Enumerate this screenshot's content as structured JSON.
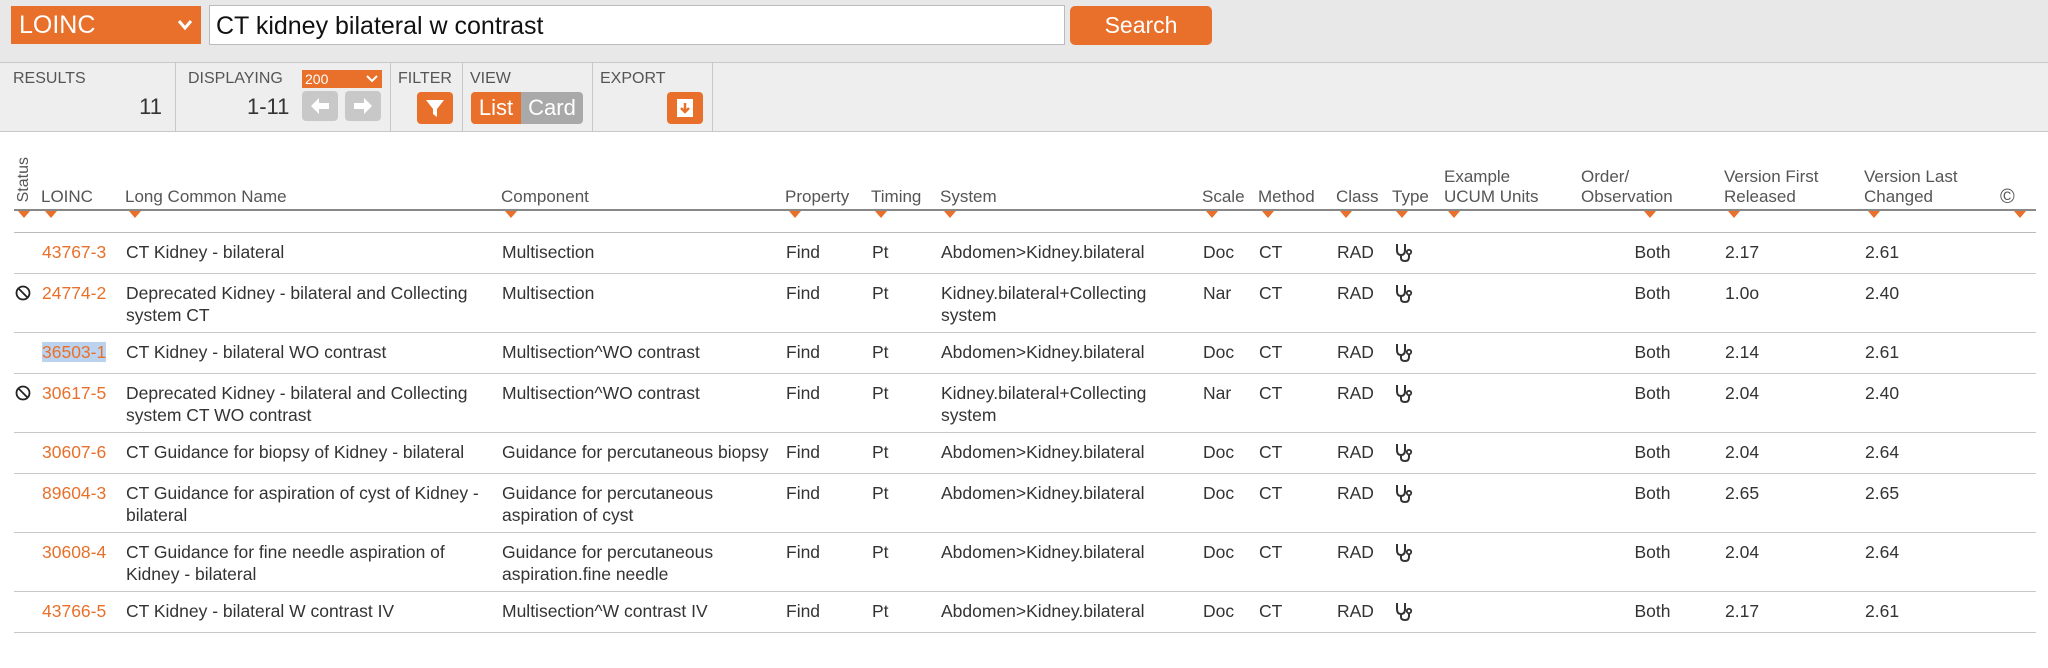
{
  "search": {
    "db": "LOINC",
    "query": "CT kidney bilateral w contrast",
    "button": "Search"
  },
  "toolbar": {
    "results_label": "RESULTS",
    "results_count": "11",
    "displaying_label": "DISPLAYING",
    "per_page": "200",
    "range": "1-11",
    "filter_label": "FILTER",
    "view_label": "VIEW",
    "view_list": "List",
    "view_card": "Card",
    "export_label": "EXPORT"
  },
  "columns": {
    "status": "Status",
    "loinc": "LOINC",
    "long_name": "Long Common Name",
    "component": "Component",
    "property": "Property",
    "timing": "Timing",
    "system": "System",
    "scale": "Scale",
    "method": "Method",
    "class": "Class",
    "type": "Type",
    "ucum_1": "Example",
    "ucum_2": "UCUM Units",
    "order_1": "Order/",
    "order_2": "Observation",
    "first_1": "Version First",
    "first_2": "Released",
    "last_1": "Version Last",
    "last_2": "Changed",
    "copyright": "©"
  },
  "rows": [
    {
      "status_icon": "",
      "loinc": "43767-3",
      "name": "CT Kidney - bilateral",
      "component": "Multisection",
      "property": "Find",
      "timing": "Pt",
      "system": "Abdomen>Kidney.bilateral",
      "scale": "Doc",
      "method": "CT",
      "class": "RAD",
      "type_icon": "stethoscope-icon",
      "ucum": "",
      "order": "Both",
      "first": "2.17",
      "last": "2.61"
    },
    {
      "status_icon": "deprecated-icon",
      "loinc": "24774-2",
      "name": "Deprecated Kidney - bilateral and Collecting system CT",
      "component": "Multisection",
      "property": "Find",
      "timing": "Pt",
      "system": "Kidney.bilateral+Collecting system",
      "scale": "Nar",
      "method": "CT",
      "class": "RAD",
      "type_icon": "stethoscope-icon",
      "ucum": "",
      "order": "Both",
      "first": "1.0o",
      "last": "2.40"
    },
    {
      "status_icon": "",
      "loinc": "36503-1",
      "name": "CT Kidney - bilateral WO contrast",
      "component": "Multisection^WO contrast",
      "property": "Find",
      "timing": "Pt",
      "system": "Abdomen>Kidney.bilateral",
      "scale": "Doc",
      "method": "CT",
      "class": "RAD",
      "type_icon": "stethoscope-icon",
      "ucum": "",
      "order": "Both",
      "first": "2.14",
      "last": "2.61"
    },
    {
      "status_icon": "deprecated-icon",
      "loinc": "30617-5",
      "name": "Deprecated Kidney - bilateral and Collecting system CT WO contrast",
      "component": "Multisection^WO contrast",
      "property": "Find",
      "timing": "Pt",
      "system": "Kidney.bilateral+Collecting system",
      "scale": "Nar",
      "method": "CT",
      "class": "RAD",
      "type_icon": "stethoscope-icon",
      "ucum": "",
      "order": "Both",
      "first": "2.04",
      "last": "2.40"
    },
    {
      "status_icon": "",
      "loinc": "30607-6",
      "name": "CT Guidance for biopsy of Kidney - bilateral",
      "component": "Guidance for percutaneous biopsy",
      "property": "Find",
      "timing": "Pt",
      "system": "Abdomen>Kidney.bilateral",
      "scale": "Doc",
      "method": "CT",
      "class": "RAD",
      "type_icon": "stethoscope-icon",
      "ucum": "",
      "order": "Both",
      "first": "2.04",
      "last": "2.64"
    },
    {
      "status_icon": "",
      "loinc": "89604-3",
      "name": "CT Guidance for aspiration of cyst of Kidney - bilateral",
      "component": "Guidance for percutaneous aspiration of cyst",
      "property": "Find",
      "timing": "Pt",
      "system": "Abdomen>Kidney.bilateral",
      "scale": "Doc",
      "method": "CT",
      "class": "RAD",
      "type_icon": "stethoscope-icon",
      "ucum": "",
      "order": "Both",
      "first": "2.65",
      "last": "2.65"
    },
    {
      "status_icon": "",
      "loinc": "30608-4",
      "name": "CT Guidance for fine needle aspiration of Kidney - bilateral",
      "component": "Guidance for percutaneous aspiration.fine needle",
      "property": "Find",
      "timing": "Pt",
      "system": "Abdomen>Kidney.bilateral",
      "scale": "Doc",
      "method": "CT",
      "class": "RAD",
      "type_icon": "stethoscope-icon",
      "ucum": "",
      "order": "Both",
      "first": "2.04",
      "last": "2.64"
    },
    {
      "status_icon": "",
      "loinc": "43766-5",
      "name": "CT Kidney - bilateral W contrast IV",
      "component": "Multisection^W contrast IV",
      "property": "Find",
      "timing": "Pt",
      "system": "Abdomen>Kidney.bilateral",
      "scale": "Doc",
      "method": "CT",
      "class": "RAD",
      "type_icon": "stethoscope-icon",
      "ucum": "",
      "order": "Both",
      "first": "2.17",
      "last": "2.61"
    }
  ],
  "colors": {
    "accent": "#e8702a",
    "selection": "#bcd3ef",
    "muted_button": "#a9a9a9"
  }
}
